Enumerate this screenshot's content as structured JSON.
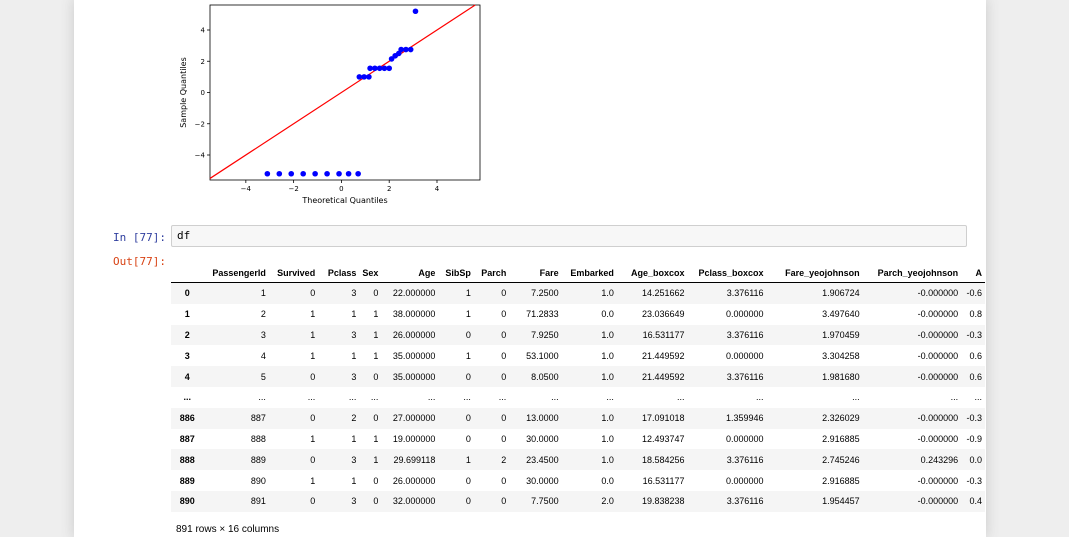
{
  "plot": {
    "xlabel": "Theoretical Quantiles",
    "ylabel": "Sample Quantiles",
    "xticks": [
      "−4",
      "−2",
      "0",
      "2",
      "4"
    ],
    "yticks": [
      "4",
      "2",
      "0",
      "−2",
      "−4"
    ],
    "line_color": "#ff0000",
    "marker_color": "#0000ff"
  },
  "chart_data": {
    "type": "scatter",
    "title": "",
    "xlabel": "Theoretical Quantiles",
    "ylabel": "Sample Quantiles",
    "xlim": [
      -5.5,
      5.8
    ],
    "ylim": [
      -5.6,
      5.6
    ],
    "reference_line": {
      "slope": 1,
      "intercept": 0
    },
    "points": [
      {
        "x": -3.1,
        "y": -5.2
      },
      {
        "x": -2.6,
        "y": -5.2
      },
      {
        "x": -2.1,
        "y": -5.2
      },
      {
        "x": -1.6,
        "y": -5.2
      },
      {
        "x": -1.1,
        "y": -5.2
      },
      {
        "x": -0.6,
        "y": -5.2
      },
      {
        "x": -0.1,
        "y": -5.2
      },
      {
        "x": 0.3,
        "y": -5.2
      },
      {
        "x": 0.7,
        "y": -5.2
      },
      {
        "x": 0.75,
        "y": 1.0
      },
      {
        "x": 0.95,
        "y": 1.0
      },
      {
        "x": 1.15,
        "y": 1.0
      },
      {
        "x": 1.2,
        "y": 1.55
      },
      {
        "x": 1.4,
        "y": 1.55
      },
      {
        "x": 1.6,
        "y": 1.55
      },
      {
        "x": 1.8,
        "y": 1.55
      },
      {
        "x": 2.0,
        "y": 1.55
      },
      {
        "x": 2.1,
        "y": 2.15
      },
      {
        "x": 2.25,
        "y": 2.35
      },
      {
        "x": 2.4,
        "y": 2.5
      },
      {
        "x": 2.5,
        "y": 2.75
      },
      {
        "x": 2.7,
        "y": 2.75
      },
      {
        "x": 2.9,
        "y": 2.75
      },
      {
        "x": 3.1,
        "y": 5.2
      }
    ]
  },
  "cell": {
    "in_prompt": "In [77]:",
    "out_prompt": "Out[77]:",
    "code": "df"
  },
  "table": {
    "columns": [
      "",
      "PassengerId",
      "Survived",
      "Pclass",
      "Sex",
      "Age",
      "SibSp",
      "Parch",
      "Fare",
      "Embarked",
      "Age_boxcox",
      "Pclass_boxcox",
      "Fare_yeojohnson",
      "Parch_yeojohnson",
      "A"
    ],
    "rows": [
      [
        "0",
        "1",
        "0",
        "3",
        "0",
        "22.000000",
        "1",
        "0",
        "7.2500",
        "1.0",
        "14.251662",
        "3.376116",
        "1.906724",
        "-0.000000",
        "-0.6"
      ],
      [
        "1",
        "2",
        "1",
        "1",
        "1",
        "38.000000",
        "1",
        "0",
        "71.2833",
        "0.0",
        "23.036649",
        "0.000000",
        "3.497640",
        "-0.000000",
        "0.8"
      ],
      [
        "2",
        "3",
        "1",
        "3",
        "1",
        "26.000000",
        "0",
        "0",
        "7.9250",
        "1.0",
        "16.531177",
        "3.376116",
        "1.970459",
        "-0.000000",
        "-0.3"
      ],
      [
        "3",
        "4",
        "1",
        "1",
        "1",
        "35.000000",
        "1",
        "0",
        "53.1000",
        "1.0",
        "21.449592",
        "0.000000",
        "3.304258",
        "-0.000000",
        "0.6"
      ],
      [
        "4",
        "5",
        "0",
        "3",
        "0",
        "35.000000",
        "0",
        "0",
        "8.0500",
        "1.0",
        "21.449592",
        "3.376116",
        "1.981680",
        "-0.000000",
        "0.6"
      ],
      [
        "...",
        "...",
        "...",
        "...",
        "...",
        "...",
        "...",
        "...",
        "...",
        "...",
        "...",
        "...",
        "...",
        "...",
        "..."
      ],
      [
        "886",
        "887",
        "0",
        "2",
        "0",
        "27.000000",
        "0",
        "0",
        "13.0000",
        "1.0",
        "17.091018",
        "1.359946",
        "2.326029",
        "-0.000000",
        "-0.3"
      ],
      [
        "887",
        "888",
        "1",
        "1",
        "1",
        "19.000000",
        "0",
        "0",
        "30.0000",
        "1.0",
        "12.493747",
        "0.000000",
        "2.916885",
        "-0.000000",
        "-0.9"
      ],
      [
        "888",
        "889",
        "0",
        "3",
        "1",
        "29.699118",
        "1",
        "2",
        "23.4500",
        "1.0",
        "18.584256",
        "3.376116",
        "2.745246",
        "0.243296",
        "0.0"
      ],
      [
        "889",
        "890",
        "1",
        "1",
        "0",
        "26.000000",
        "0",
        "0",
        "30.0000",
        "0.0",
        "16.531177",
        "0.000000",
        "2.916885",
        "-0.000000",
        "-0.3"
      ],
      [
        "890",
        "891",
        "0",
        "3",
        "0",
        "32.000000",
        "0",
        "0",
        "7.7500",
        "2.0",
        "19.838238",
        "3.376116",
        "1.954457",
        "-0.000000",
        "0.4"
      ]
    ],
    "row_count": "891 rows × 16 columns"
  }
}
